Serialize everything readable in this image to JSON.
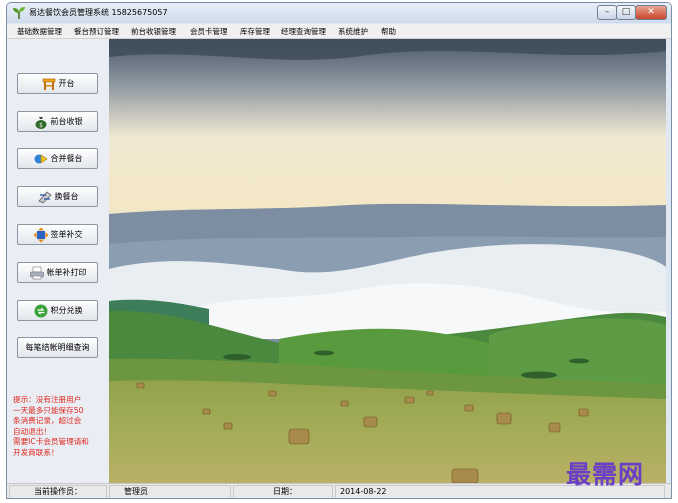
{
  "window": {
    "title": "易达餐饮会员管理系统 15825675057",
    "controls": {
      "minimize": "–",
      "maximize": "□",
      "close": "✕"
    }
  },
  "menubar": {
    "items": [
      {
        "label": "基础数据管理"
      },
      {
        "label": "餐台预订管理"
      },
      {
        "label": "前台收银管理"
      },
      {
        "label": "会员卡管理"
      },
      {
        "label": "库存管理"
      },
      {
        "label": "经理查询管理"
      },
      {
        "label": "系统维护"
      },
      {
        "label": "帮助"
      }
    ]
  },
  "sidebar": {
    "buttons": [
      {
        "label": "开台",
        "icon": "table-icon"
      },
      {
        "label": "前台收银",
        "icon": "money-bag-icon"
      },
      {
        "label": "合并餐台",
        "icon": "merge-icon"
      },
      {
        "label": "换餐台",
        "icon": "swap-icon"
      },
      {
        "label": "签单补交",
        "icon": "arrows-icon"
      },
      {
        "label": "帐单补打印",
        "icon": "printer-icon"
      },
      {
        "label": "积分兑换",
        "icon": "exchange-icon"
      },
      {
        "label": "每笔结帐明细查询",
        "icon": ""
      }
    ],
    "hint_lines": [
      "提示：没有注册用户",
      "一天最多只能保存50",
      "条消费记录，超过会",
      "自动退出！",
      "需要IC卡会员管理请和",
      "开发商联系！"
    ],
    "hint_color": "#e0251b"
  },
  "statusbar": {
    "operator_label": "当前操作员：",
    "operator_value": "管理员",
    "date_label": "日期：",
    "date_value": "2014-08-22"
  },
  "watermark": "最需网"
}
